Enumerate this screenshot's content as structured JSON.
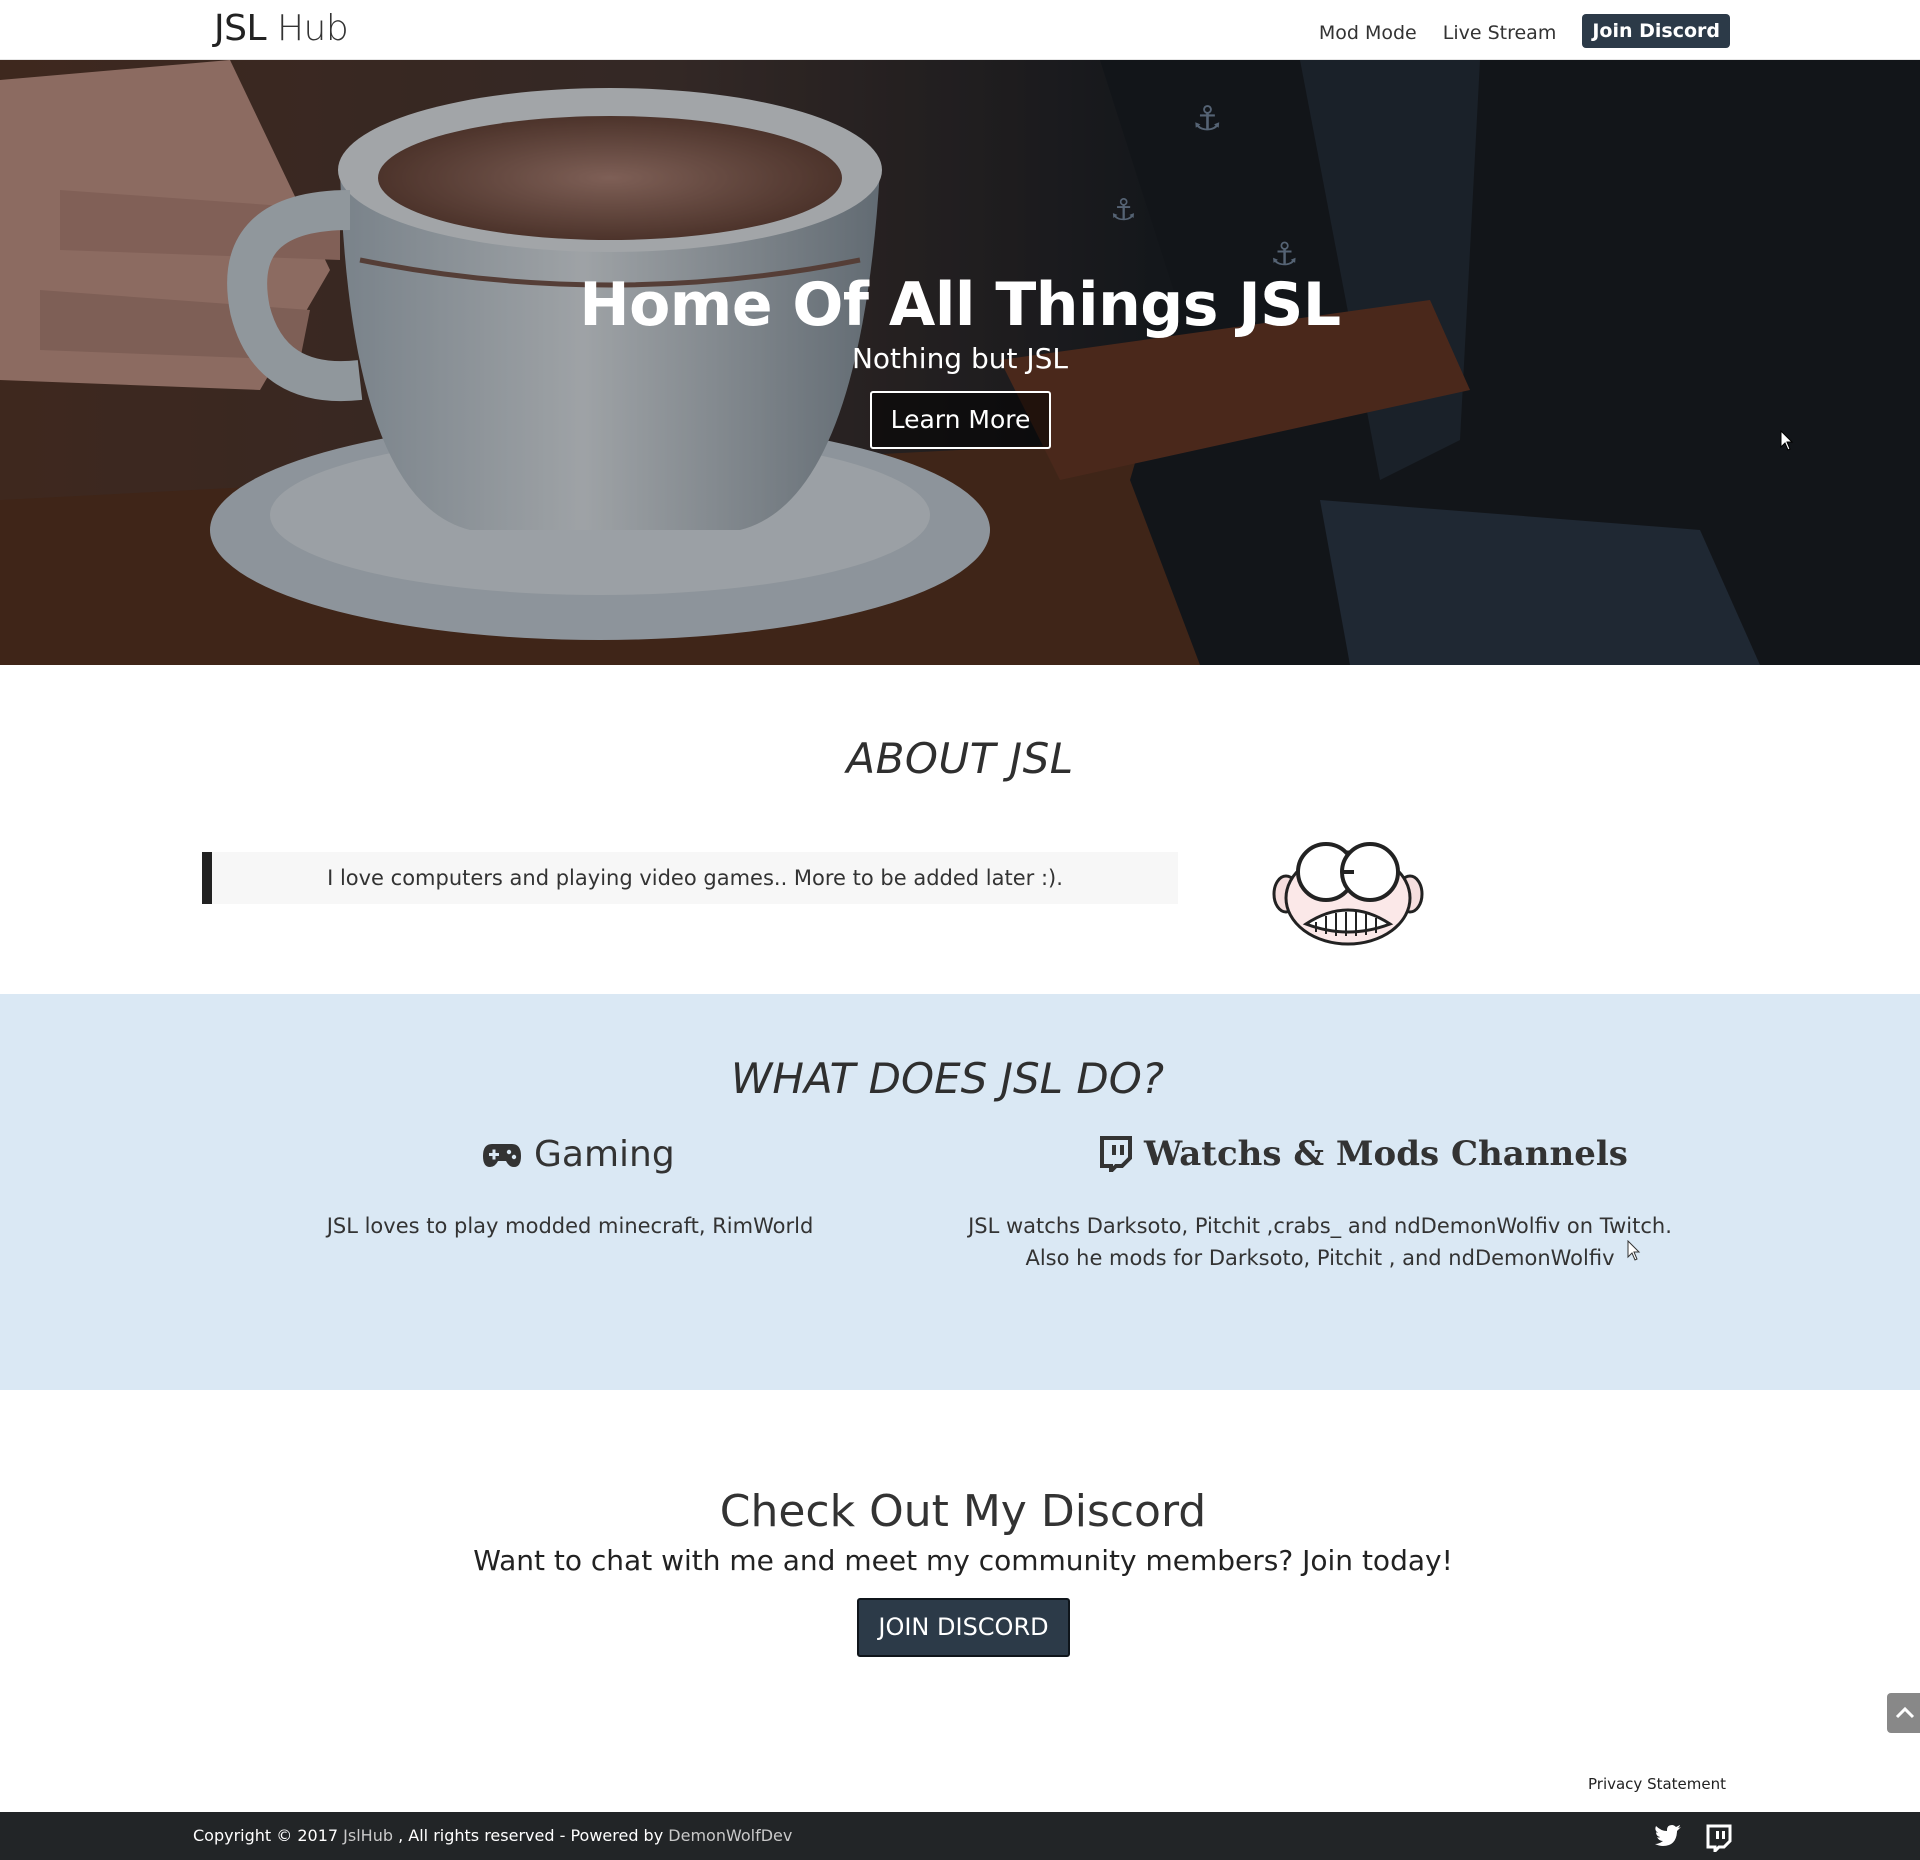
{
  "navbar": {
    "brand_main": "JSL",
    "brand_sub": "Hub",
    "links": [
      "Mod Mode",
      "Live Stream"
    ],
    "join_label": "Join Discord"
  },
  "hero": {
    "title": "Home Of All Things JSL",
    "subtitle": "Nothing but JSL",
    "button_label": "Learn More"
  },
  "about": {
    "title": "ABOUT JSL",
    "quote": "I love computers and playing video games.. More to be added later :)."
  },
  "what_does": {
    "title": "WHAT DOES JSL DO?",
    "gaming": {
      "icon": "gamepad-icon",
      "title": "Gaming",
      "text": "JSL loves to play modded minecraft, RimWorld"
    },
    "watch": {
      "icon": "twitch-icon",
      "title": "Watchs & Mods Channels",
      "line1": "JSL watchs Darksoto, Pitchit ,crabs_ and ndDemonWolfiv on Twitch.",
      "line2": "Also he mods for Darksoto, Pitchit , and ndDemonWolfiv"
    }
  },
  "discord": {
    "title": "Check Out My Discord",
    "subtitle": "Want to chat with me and meet my community members? Join today!",
    "button_label": "JOIN DISCORD"
  },
  "privacy_label": "Privacy Statement",
  "footer": {
    "copyright_prefix": "Copyright © 2017",
    "site_link": "JslHub",
    "middle": ", All rights reserved - Powered by",
    "dev_link": "DemonWolfDev",
    "icons": [
      "twitter-icon",
      "twitch-icon"
    ]
  },
  "colors": {
    "nav_button": "#2c3a48",
    "section_blue": "#dae8f4",
    "footer_bg": "#222527"
  }
}
